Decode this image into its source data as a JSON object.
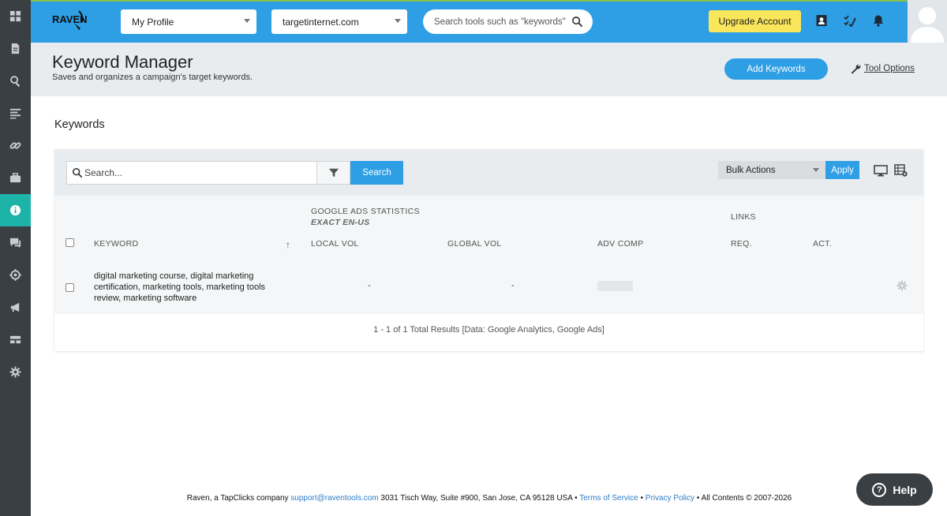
{
  "logo_text": "RAVEN",
  "topbar": {
    "profile_dropdown": "My Profile",
    "site_dropdown": "targetinternet.com",
    "search_placeholder": "Search tools such as \"keywords\"",
    "upgrade_label": "Upgrade Account"
  },
  "header": {
    "title": "Keyword Manager",
    "subtitle": "Saves and organizes a campaign's target keywords.",
    "add_keywords_label": "Add Keywords",
    "tool_options_label": "Tool Options"
  },
  "section": {
    "title": "Keywords"
  },
  "toolbar": {
    "search_placeholder": "Search...",
    "search_button": "Search",
    "bulk_actions": "Bulk Actions",
    "apply_button": "Apply"
  },
  "table": {
    "group_google": "GOOGLE ADS STATISTICS",
    "group_google_sub": "EXACT EN-US",
    "group_links": "LINKS",
    "sort_arrow": "↑",
    "columns": {
      "keyword": "KEYWORD",
      "local_vol": "LOCAL VOL",
      "global_vol": "GLOBAL VOL",
      "adv_comp": "ADV COMP",
      "req": "REQ.",
      "act": "ACT."
    },
    "rows": [
      {
        "keyword": "digital marketing course, digital marketing certification, marketing tools, marketing tools review, marketing software",
        "local_vol": "-",
        "global_vol": "-"
      }
    ],
    "results_text": "1 - 1 of 1 Total Results [Data: Google Analytics, Google Ads]"
  },
  "footer": {
    "company": "Raven, a TapClicks company",
    "email": "support@raventools.com",
    "address": "3031 Tisch Way, Suite #900, San Jose, CA 95128 USA",
    "sep1": "•",
    "terms": "Terms of Service",
    "sep2": "•",
    "privacy": "Privacy Policy",
    "sep3": "•",
    "copyright": "All Contents © 2007-2026"
  },
  "help_label": "Help",
  "colors": {
    "accent_blue": "#2e9ee5",
    "active_teal": "#1eb3a9",
    "rail": "#3a3f44",
    "upgrade_yellow": "#f9e65a"
  },
  "sidebar_icons": [
    "dashboard-icon",
    "document-icon",
    "search-icon",
    "list-icon",
    "link-icon",
    "briefcase-icon",
    "info-icon",
    "chat-icon",
    "target-icon",
    "megaphone-icon",
    "layout-icon",
    "gear-icon"
  ]
}
